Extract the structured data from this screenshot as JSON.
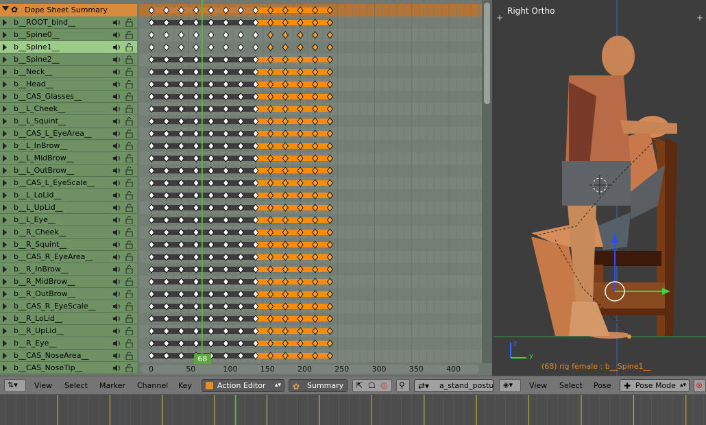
{
  "dopesheet": {
    "summary_label": "Dope Sheet Summary",
    "channels": [
      "b__ROOT_bind__",
      "b__Spine0__",
      "b__Spine1__",
      "b__Spine2__",
      "b__Neck__",
      "b__Head__",
      "b__CAS_Glasses__",
      "b__L_Cheek__",
      "b__L_Squint__",
      "b__CAS_L_EyeArea__",
      "b__L_InBrow__",
      "b__L_MidBrow__",
      "b__L_OutBrow__",
      "b__CAS_L_EyeScale__",
      "b__L_LoLid__",
      "b__L_UpLid__",
      "b__L_Eye__",
      "b__R_Cheek__",
      "b__R_Squint__",
      "b__CAS_R_EyeArea__",
      "b__R_InBrow__",
      "b__R_MidBrow__",
      "b__R_OutBrow__",
      "b__CAS_R_EyeScale__",
      "b__R_LoLid__",
      "b__R_UpLid__",
      "b__R_Eye__",
      "b__CAS_NoseArea__",
      "b__CAS_NoseTip__"
    ],
    "selected_channel": "b__Spine1__",
    "keyframe_frames": [
      0,
      20,
      40,
      60,
      80,
      100,
      120,
      140,
      160,
      180,
      200,
      220,
      240
    ],
    "ruler_ticks": [
      "0",
      "50",
      "100",
      "150",
      "200",
      "250",
      "300",
      "350",
      "400"
    ],
    "current_frame": "68",
    "colors": {
      "summary": "#d88b3c",
      "channel_bg": "#6e9264",
      "selected_channel": "#9ccc8a",
      "keyframe_selected": "#f8a028",
      "hold_bar": "#f98c0a",
      "playhead": "#5ab43c"
    }
  },
  "header": {
    "menus": [
      "View",
      "Select",
      "Marker",
      "Channel",
      "Key"
    ],
    "mode": "Action Editor",
    "summary_toggle": "Summary",
    "action_name": "a_stand_posture"
  },
  "viewport": {
    "title": "Right Ortho",
    "info": "(68) rig female : b__Spine1__",
    "menus": [
      "View",
      "Select",
      "Pose"
    ],
    "mode": "Pose Mode",
    "axis_y": "y",
    "axis_z": "z"
  }
}
